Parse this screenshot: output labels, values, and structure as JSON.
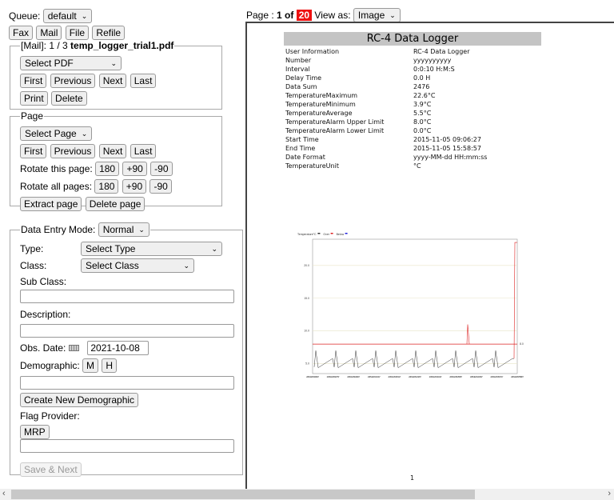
{
  "queue": {
    "label": "Queue:",
    "value": "default"
  },
  "actions": [
    "Fax",
    "Mail",
    "File",
    "Refile"
  ],
  "mail": {
    "prefix": "[Mail]: 1 / 3 ",
    "filename": "temp_logger_trial1.pdf",
    "select": "Select PDF",
    "nav": [
      "First",
      "Previous",
      "Next",
      "Last"
    ],
    "ops": [
      "Print",
      "Delete"
    ]
  },
  "page": {
    "legend": "Page",
    "select": "Select Page",
    "nav": [
      "First",
      "Previous",
      "Next",
      "Last"
    ],
    "rotate_this": "Rotate this page:",
    "rotate_all": "Rotate all pages:",
    "rotations": [
      "180",
      "+90",
      "-90"
    ],
    "extract": "Extract page",
    "delete": "Delete page"
  },
  "entry": {
    "mode_label": "Data Entry Mode:",
    "mode": "Normal",
    "type_label": "Type:",
    "type": "Select Type",
    "class_label": "Class:",
    "class": "Select Class",
    "subclass_label": "Sub Class:",
    "subclass": "",
    "description_label": "Description:",
    "description": "",
    "obs_label": "Obs. Date:",
    "obs_date": "2021-10-08",
    "demo_label": "Demographic:",
    "demo_m": "M",
    "demo_h": "H",
    "demographic": "",
    "create_demo": "Create New Demographic",
    "flag_label": "Flag Provider:",
    "mrp": "MRP",
    "provider": "",
    "save_next": "Save & Next"
  },
  "viewer": {
    "page_label": "Page : ",
    "current": "1",
    "of": " of ",
    "total": "20",
    "view_as": "View as:",
    "view_mode": "Image",
    "total_color": "#ee1111"
  },
  "document": {
    "title": "RC-4 Data Logger",
    "rows": [
      [
        "User Information",
        "RC-4 Data Logger"
      ],
      [
        "Number",
        "yyyyyyyyyy"
      ],
      [
        "Interval",
        "0:0:10 H:M:S"
      ],
      [
        "Delay Time",
        "0.0 H"
      ],
      [
        "Data Sum",
        "2476"
      ],
      [
        "TemperatureMaximum",
        "22.6°C"
      ],
      [
        "TemperatureMinimum",
        "3.9°C"
      ],
      [
        "TemperatureAverage",
        "5.5°C"
      ],
      [
        "TemperatureAlarm Upper Limit",
        "8.0°C"
      ],
      [
        "TemperatureAlarm Lower Limit",
        "0.0°C"
      ],
      [
        "Start Time",
        "2015-11-05 09:06:27"
      ],
      [
        "End Time",
        "2015-11-05 15:58:57"
      ],
      [
        "Date Format",
        "yyyy-MM-dd HH:mm:ss"
      ],
      [
        "TemperatureUnit",
        "°C"
      ]
    ],
    "page_number": "1"
  },
  "chart_data": {
    "type": "line",
    "legend": [
      "Temperature°C",
      "Over",
      "Below"
    ],
    "legend_placement": "top-left",
    "series_colors": [
      "#333333",
      "#dd2222",
      "#2222dd"
    ],
    "yticks": [
      "5.0",
      "10.0",
      "15.0",
      "20.0"
    ],
    "ylim": [
      3.5,
      24
    ],
    "upper_limit": 8.0,
    "upper_limit_label": "8.0",
    "xticks": [
      "2015-11-05 09:06:47",
      "2015-11-05 09:47:57",
      "2015-11-05 10:29:07",
      "2015-11-05 11:10:17",
      "2015-11-05 11:51:27",
      "2015-11-05 12:32:37",
      "2015-11-05 13:13:47",
      "2015-11-05 13:54:57",
      "2015-11-05 14:36:07",
      "2015-11-05 15:17:17",
      "2015-11-05 15:58:27"
    ],
    "xunit": "Time",
    "grid": true
  }
}
